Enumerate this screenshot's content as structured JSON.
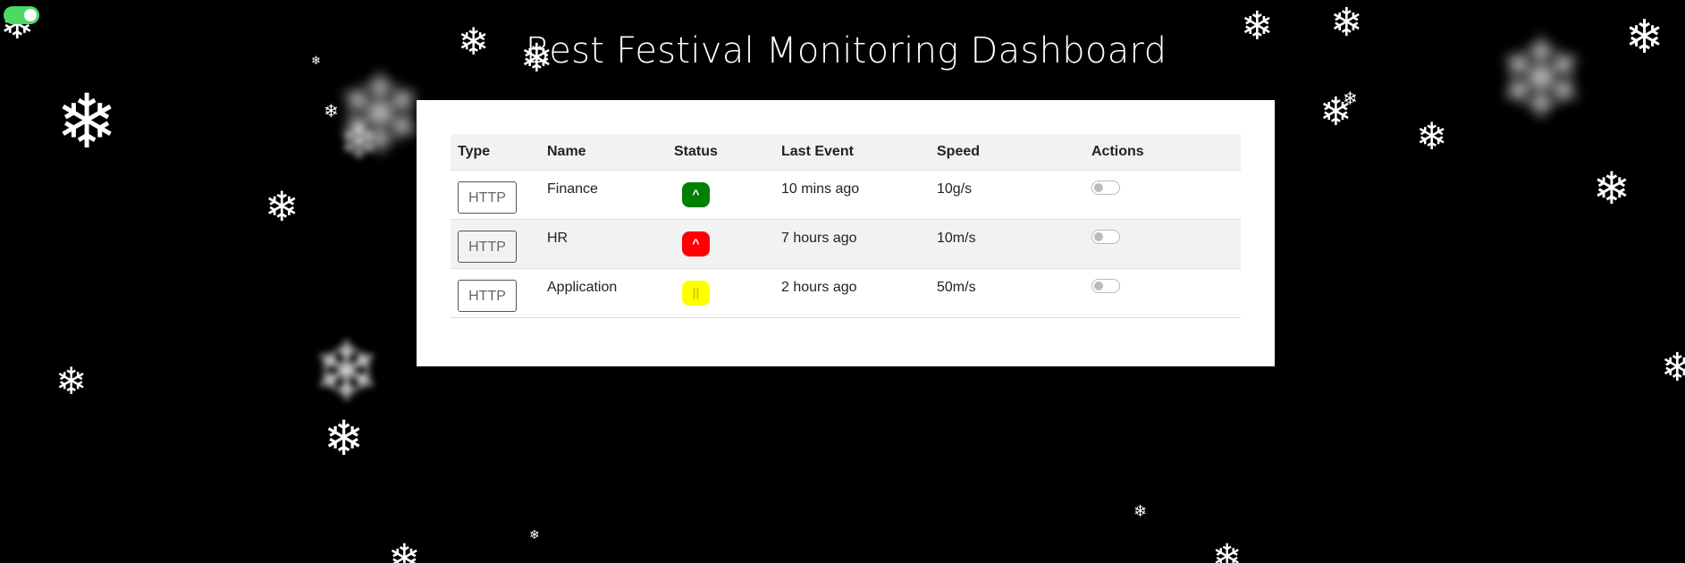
{
  "header": {
    "title": "Best Festival Monitoring Dashboard"
  },
  "theme_toggle": {
    "state": "on",
    "color": "#4cd964"
  },
  "table": {
    "columns": [
      "Type",
      "Name",
      "Status",
      "Last Event",
      "Speed",
      "Actions"
    ],
    "rows": [
      {
        "type": "HTTP",
        "name": "Finance",
        "status": {
          "symbol": "^",
          "color": "#008000",
          "text_color": "#ffffff"
        },
        "last_event": "10 mins ago",
        "speed": "10g/s",
        "action_toggle": "off"
      },
      {
        "type": "HTTP",
        "name": "HR",
        "status": {
          "symbol": "^",
          "color": "#ff0000",
          "text_color": "#ffffff"
        },
        "last_event": "7 hours ago",
        "speed": "10m/s",
        "action_toggle": "off"
      },
      {
        "type": "HTTP",
        "name": "Application",
        "status": {
          "symbol": "||",
          "color": "#ffff00",
          "text_color": "#cccc00"
        },
        "last_event": "2 hours ago",
        "speed": "50m/s",
        "action_toggle": "off"
      }
    ]
  },
  "background": {
    "color": "#000000",
    "decoration": "snowflake-icon"
  }
}
